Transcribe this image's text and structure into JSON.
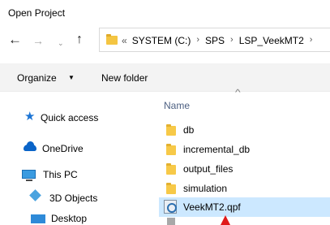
{
  "window": {
    "title": "Open Project"
  },
  "nav_buttons": {
    "back_icon": "←",
    "forward_icon": "→",
    "recent_icon": "⌄",
    "up_icon": "↑"
  },
  "address": {
    "lead": "«",
    "crumbs": [
      "SYSTEM (C:)",
      "SPS",
      "LSP_VeekMT2"
    ],
    "separator": "›"
  },
  "toolbar": {
    "organize_label": "Organize",
    "organize_arrow": "▼",
    "new_folder_label": "New folder"
  },
  "sidebar": {
    "items": [
      {
        "label": "Quick access",
        "icon": "star-icon"
      },
      {
        "label": "OneDrive",
        "icon": "cloud-icon"
      },
      {
        "label": "This PC",
        "icon": "computer-icon"
      },
      {
        "label": "3D Objects",
        "icon": "cube-icon"
      },
      {
        "label": "Desktop",
        "icon": "desktop-icon"
      }
    ]
  },
  "file_list": {
    "column_header": "Name",
    "sort_caret": "^",
    "rows": [
      {
        "name": "db",
        "type": "folder"
      },
      {
        "name": "incremental_db",
        "type": "folder"
      },
      {
        "name": "output_files",
        "type": "folder"
      },
      {
        "name": "simulation",
        "type": "folder"
      },
      {
        "name": "VeekMT2.qpf",
        "type": "file",
        "selected": true
      }
    ]
  },
  "colors": {
    "accent": "#1c74d4",
    "selection": "#cce8ff",
    "folder": "#f7c948",
    "pointer": "#e01b1b"
  }
}
